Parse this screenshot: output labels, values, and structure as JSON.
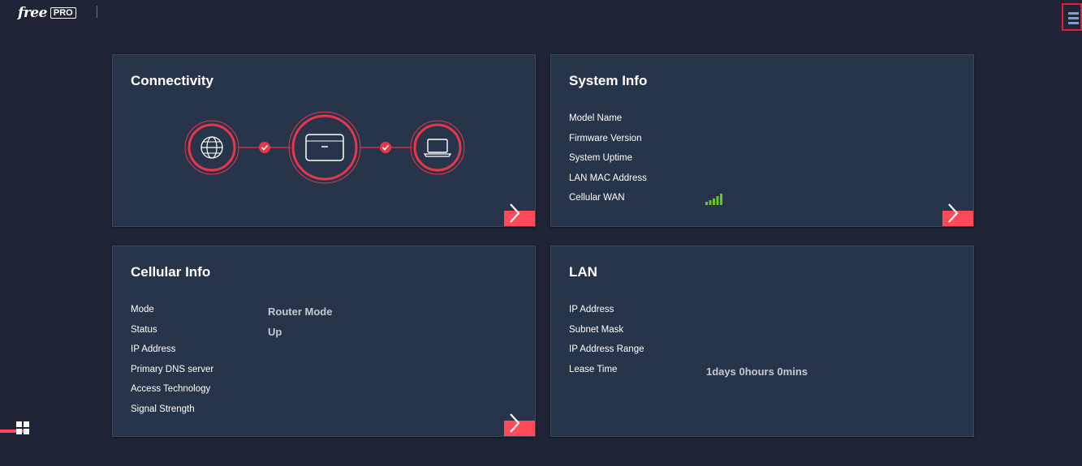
{
  "brand": {
    "name": "free",
    "badge": "PRO"
  },
  "header": {
    "menu_icon": "hamburger-menu-icon"
  },
  "cards": {
    "connectivity": {
      "title": "Connectivity",
      "nodes": [
        "globe-icon",
        "router-icon",
        "laptop-icon"
      ],
      "status_color": "#e8364a"
    },
    "system_info": {
      "title": "System Info",
      "labels": [
        "Model Name",
        "Firmware Version",
        "System Uptime",
        "LAN MAC Address",
        "Cellular WAN"
      ],
      "signal_color": "#6cc520",
      "signal_level": 1.0
    },
    "cellular_info": {
      "title": "Cellular Info",
      "labels": [
        "Mode",
        "Status",
        "IP Address",
        "Primary DNS server",
        "Access Technology",
        "Signal Strength"
      ],
      "values": [
        "Router Mode",
        "Up"
      ]
    },
    "lan": {
      "title": "LAN",
      "labels": [
        "IP Address",
        "Subnet Mask",
        "IP Address Range",
        "Lease Time"
      ],
      "lease_time": "1days 0hours 0mins"
    }
  },
  "colors": {
    "background": "#1f2536",
    "card": "#28344a",
    "accent": "#ff4a5a"
  },
  "footer": {
    "dashboard_icon": "dashboard-grid-icon"
  }
}
